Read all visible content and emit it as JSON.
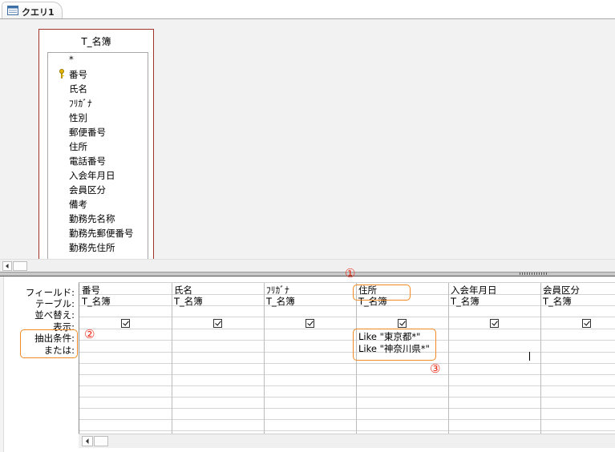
{
  "tab": {
    "title": "クエリ1",
    "icon": "query-icon"
  },
  "table": {
    "name": "T_名簿",
    "fields": [
      "*",
      "番号",
      "氏名",
      "ﾌﾘｶﾞﾅ",
      "性別",
      "郵便番号",
      "住所",
      "電話番号",
      "入会年月日",
      "会員区分",
      "備考",
      "勤務先名称",
      "勤務先郵便番号",
      "勤務先住所"
    ]
  },
  "grid": {
    "row_labels": [
      "フィールド:",
      "テーブル:",
      "並べ替え:",
      "表示:",
      "抽出条件:",
      "または:"
    ],
    "columns": [
      {
        "field": "番号",
        "table": "T_名簿",
        "show": true,
        "criteria": "",
        "or": ""
      },
      {
        "field": "氏名",
        "table": "T_名簿",
        "show": true,
        "criteria": "",
        "or": ""
      },
      {
        "field": "ﾌﾘｶﾞﾅ",
        "table": "T_名簿",
        "show": true,
        "criteria": "",
        "or": ""
      },
      {
        "field": "住所",
        "table": "T_名簿",
        "show": true,
        "criteria": "Like \"東京都*\"",
        "or": "Like \"神奈川県*\""
      },
      {
        "field": "入会年月日",
        "table": "T_名簿",
        "show": true,
        "criteria": "",
        "or": ""
      },
      {
        "field": "会員区分",
        "table": "T_名簿",
        "show": true,
        "criteria": "",
        "or": ""
      }
    ]
  },
  "annotations": {
    "n1": "①",
    "n2": "②",
    "n3": "③"
  },
  "colors": {
    "annotation_box": "#f08a24",
    "annotation_number": "#e8301c",
    "table_border": "#a0332b"
  }
}
